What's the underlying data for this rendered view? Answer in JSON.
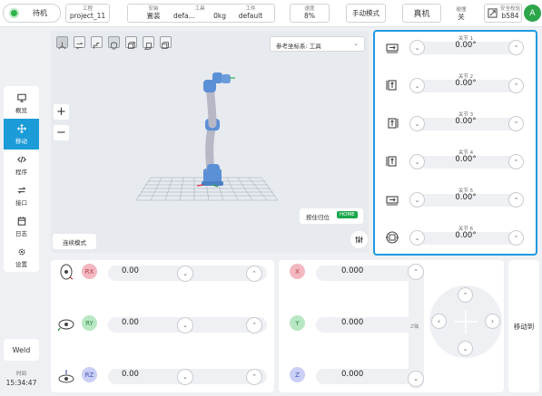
{
  "status": {
    "label": "待机"
  },
  "project": {
    "label": "工程",
    "value": "project_11"
  },
  "install": {
    "label": "安装",
    "value": "置装"
  },
  "tool": {
    "label": "工具",
    "value": "defa...",
    "weight": "0kg"
  },
  "workpiece": {
    "label": "工件",
    "value": "default"
  },
  "speed": {
    "label": "速度",
    "value": "8%"
  },
  "manual_mode": "手动模式",
  "real_machine": "真机",
  "collision": {
    "label": "碰撞",
    "value": "关"
  },
  "safety": {
    "label": "安全校验",
    "value": "b584"
  },
  "avatar": "A",
  "nav": {
    "overview": "概览",
    "move": "移动",
    "program": "程序",
    "interface": "接口",
    "log": "日志",
    "settings": "设置"
  },
  "weld": "Weld",
  "time": {
    "label": "时间",
    "value": "15:34:47"
  },
  "viewport": {
    "coord_system": "参考坐标系: 工具",
    "hold_home": "按住归位",
    "home_badge": "HOME",
    "continuous_mode": "连续模式"
  },
  "joints": [
    {
      "name": "关节 1",
      "value": "0.00°"
    },
    {
      "name": "关节 2",
      "value": "0.00°"
    },
    {
      "name": "关节 3",
      "value": "0.00°"
    },
    {
      "name": "关节 4",
      "value": "0.00°"
    },
    {
      "name": "关节 5",
      "value": "0.00°"
    },
    {
      "name": "关节 6",
      "value": "0.00°"
    }
  ],
  "rotation": [
    {
      "label": "RX",
      "value": "0.00",
      "color": "#f3b8bf",
      "text": "#b04050"
    },
    {
      "label": "RY",
      "value": "0.00",
      "color": "#b9e7c4",
      "text": "#2c8a45"
    },
    {
      "label": "RZ",
      "value": "0.00",
      "color": "#c9cff5",
      "text": "#4a56b0"
    }
  ],
  "position": [
    {
      "label": "X",
      "value": "0.000",
      "color": "#f3b8bf",
      "text": "#b04050"
    },
    {
      "label": "Y",
      "value": "0.000",
      "color": "#b9e7c4",
      "text": "#2c8a45"
    },
    {
      "label": "Z",
      "value": "0.000",
      "color": "#c9cff5",
      "text": "#4a56b0"
    }
  ],
  "z_axis_label": "Z轴",
  "move_to": "移动到",
  "colors": {
    "accent": "#1b9bd8",
    "joint_border": "#1f9be0",
    "home_badge": "#1aa64a",
    "status_dot": "#2fb34a"
  }
}
